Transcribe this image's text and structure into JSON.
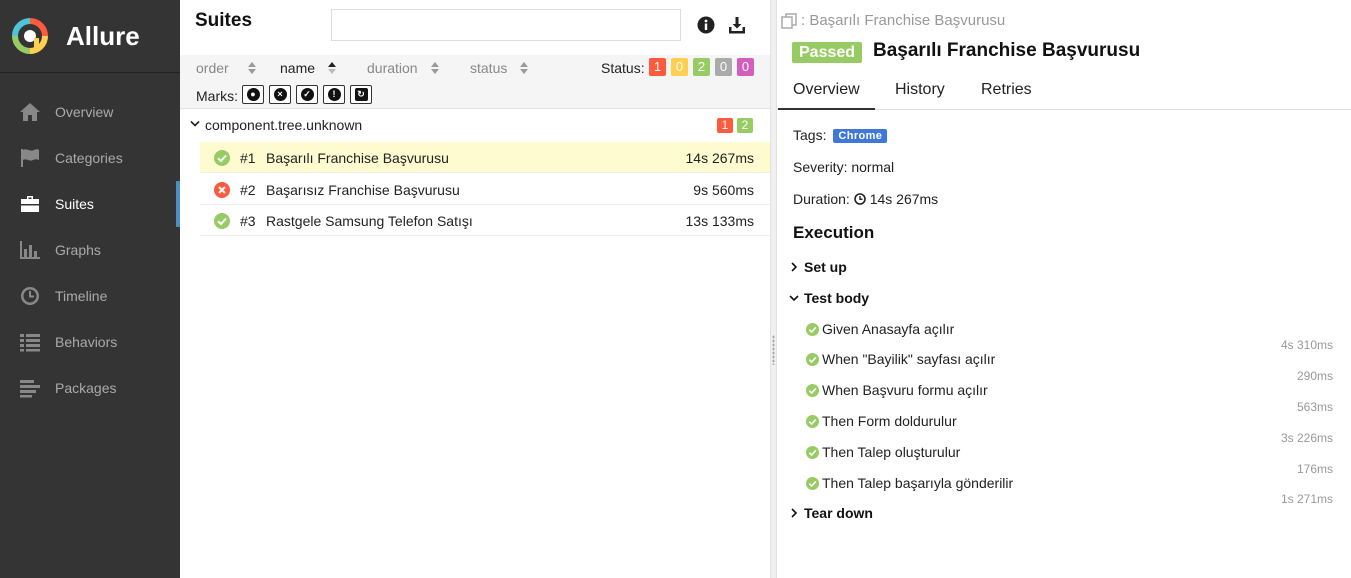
{
  "app": {
    "name": "Allure"
  },
  "sidebar": {
    "items": [
      {
        "label": "Overview",
        "icon": "home-icon"
      },
      {
        "label": "Categories",
        "icon": "flag-icon"
      },
      {
        "label": "Suites",
        "icon": "briefcase-icon",
        "active": true
      },
      {
        "label": "Graphs",
        "icon": "bar-chart-icon"
      },
      {
        "label": "Timeline",
        "icon": "clock-icon"
      },
      {
        "label": "Behaviors",
        "icon": "list-icon"
      },
      {
        "label": "Packages",
        "icon": "align-left-icon"
      }
    ]
  },
  "suites": {
    "title": "Suites",
    "search": {
      "value": "",
      "placeholder": ""
    },
    "sort": {
      "order": "order",
      "name": "name",
      "duration": "duration",
      "status": "status"
    },
    "status_label": "Status:",
    "status_counts": [
      {
        "value": "1",
        "color": "#fd5a3e"
      },
      {
        "value": "0",
        "color": "#ffd050"
      },
      {
        "value": "2",
        "color": "#97cc64"
      },
      {
        "value": "0",
        "color": "#aaaaaa"
      },
      {
        "value": "0",
        "color": "#d35ebe"
      }
    ],
    "marks_label": "Marks:",
    "group": {
      "name": "component.tree.unknown",
      "failed": "1",
      "passed": "2"
    },
    "rows": [
      {
        "num": "#1",
        "name": "Başarılı Franchise Başvurusu",
        "duration": "14s 267ms",
        "status": "passed"
      },
      {
        "num": "#2",
        "name": "Başarısız Franchise Başvurusu",
        "duration": "9s 560ms",
        "status": "failed"
      },
      {
        "num": "#3",
        "name": "Rastgele Samsung Telefon Satışı",
        "duration": "13s 133ms",
        "status": "passed"
      }
    ]
  },
  "details": {
    "breadcrumb": ": Başarılı Franchise Başvurusu",
    "status": "Passed",
    "title": "Başarılı Franchise Başvurusu",
    "tabs": [
      "Overview",
      "History",
      "Retries"
    ],
    "tags_label": "Tags:",
    "tag": "Chrome",
    "severity": "Severity: normal",
    "duration_label": "Duration:",
    "duration": "14s 267ms",
    "execution": "Execution",
    "setup": "Set up",
    "test_body": "Test body",
    "teardown": "Tear down",
    "steps": [
      {
        "name": "Given Anasayfa açılır",
        "duration": "4s 310ms"
      },
      {
        "name": "When \"Bayilik\" sayfası açılır",
        "duration": "290ms"
      },
      {
        "name": "When Başvuru formu açılır",
        "duration": "563ms"
      },
      {
        "name": "Then Form doldurulur",
        "duration": "3s 226ms"
      },
      {
        "name": "Then Talep oluşturulur",
        "duration": "176ms"
      },
      {
        "name": "Then Talep başarıyla gönderilir",
        "duration": "1s 271ms"
      }
    ]
  },
  "colors": {
    "passed": "#97cc64",
    "failed": "#fd5a3e",
    "accent": "#4a8ec2",
    "tag": "#3f78d9"
  }
}
